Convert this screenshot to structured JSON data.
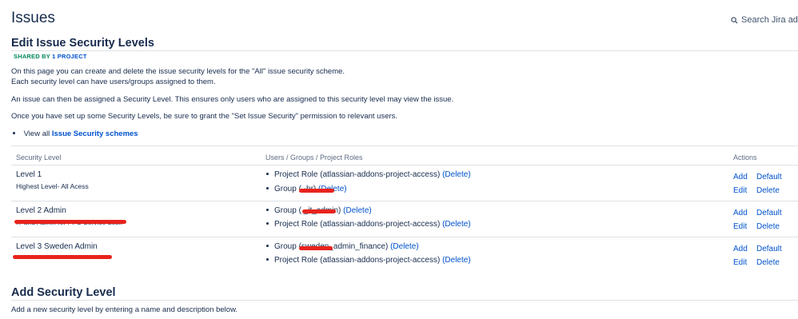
{
  "header": {
    "title": "Issues",
    "search_label": "Search Jira adm"
  },
  "section": {
    "title": "Edit Issue Security Levels",
    "shared_prefix": "SHARED BY",
    "shared_link": "1 PROJECT"
  },
  "intro": {
    "line1": "On this page you can create and delete the issue security levels for the \"All\" issue security scheme.",
    "line2": "Each security level can have users/groups assigned to them.",
    "line3": "An issue can then be assigned a Security Level. This ensures only users who are assigned to this security level may view the issue.",
    "line4": "Once you have set up some Security Levels, be sure to grant the \"Set Issue Security\" permission to relevant users.",
    "view_all_prefix": "View all",
    "view_all_link": "Issue Security schemes"
  },
  "table": {
    "headers": {
      "level": "Security Level",
      "users": "Users / Groups / Project Roles",
      "actions": "Actions"
    },
    "rows": [
      {
        "name": "Level 1",
        "description": "Highest Level- All Acess",
        "entries": [
          {
            "text": "Project Role (atlassian-addons-project-access)",
            "delete": "(Delete)"
          },
          {
            "text": "Group (            -hr)",
            "delete": "(Delete)"
          }
        ],
        "actions": {
          "add": "Add",
          "default": "Default",
          "edit": "Edit",
          "delete": "Delete"
        }
      },
      {
        "name": "Level 2 Admin",
        "description": "IT and Admin for PPS Service desk",
        "entries": [
          {
            "text": "Group (          _it_admin)",
            "delete": "(Delete)"
          },
          {
            "text": "Project Role (atlassian-addons-project-access)",
            "delete": "(Delete)"
          }
        ],
        "actions": {
          "add": "Add",
          "default": "Default",
          "edit": "Edit",
          "delete": "Delete"
        }
      },
      {
        "name": "Level 3 Sweden Admin",
        "description": "",
        "entries": [
          {
            "text": "Group (sweden_admin_finance)",
            "delete": "(Delete)"
          },
          {
            "text": "Project Role (atlassian-addons-project-access)",
            "delete": "(Delete)"
          }
        ],
        "actions": {
          "add": "Add",
          "default": "Default",
          "edit": "Edit",
          "delete": "Delete"
        }
      }
    ]
  },
  "add_section": {
    "title": "Add Security Level",
    "description": "Add a new security level by entering a name and description below."
  },
  "colors": {
    "text": "#172b4d",
    "link": "#0052cc",
    "shared_green": "#00875a",
    "redaction": "#e8231c",
    "border": "#dfe1e6"
  }
}
